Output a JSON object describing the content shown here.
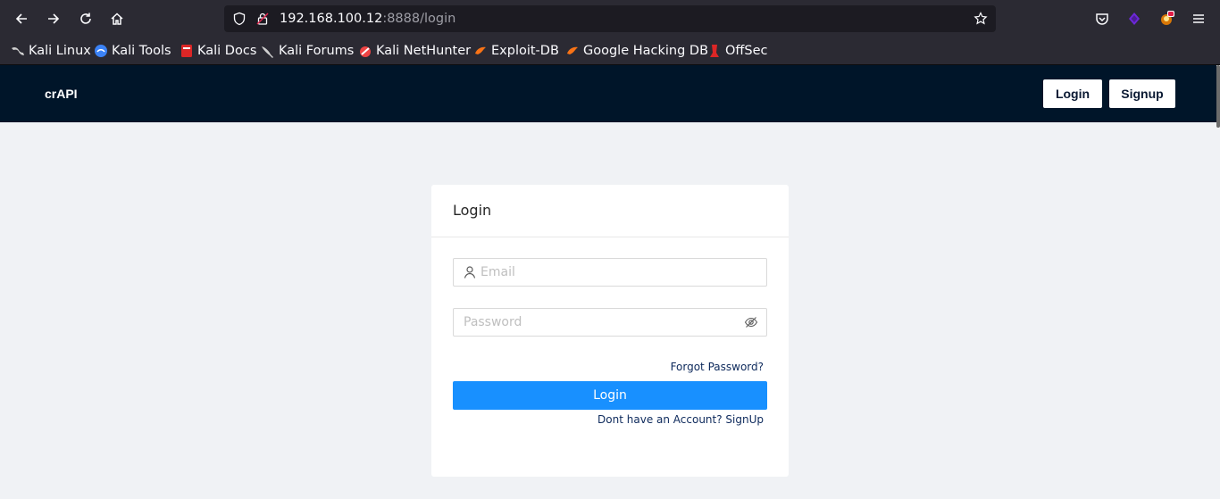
{
  "browser": {
    "url_host": "192.168.100.12",
    "url_rest": ":8888/login",
    "nav_icons": [
      "back-icon",
      "forward-icon",
      "reload-icon",
      "home-icon"
    ],
    "right_icons": [
      "pocket-icon",
      "extension-icon",
      "profile-icon",
      "menu-icon"
    ]
  },
  "bookmarks": [
    {
      "label": "Kali Linux",
      "icon": "kali-dragon-icon",
      "color": "#cfcfcf"
    },
    {
      "label": "Kali Tools",
      "icon": "kali-tools-icon",
      "color": "#3b82f6"
    },
    {
      "label": "Kali Docs",
      "icon": "kali-docs-icon",
      "color": "#dc2626"
    },
    {
      "label": "Kali Forums",
      "icon": "kali-forums-icon",
      "color": "#cfcfcf"
    },
    {
      "label": "Kali NetHunter",
      "icon": "nethunter-icon",
      "color": "#ef4444"
    },
    {
      "label": "Exploit-DB",
      "icon": "exploit-db-icon",
      "color": "#f97316"
    },
    {
      "label": "Google Hacking DB",
      "icon": "ghdb-icon",
      "color": "#f97316"
    },
    {
      "label": "OffSec",
      "icon": "offsec-icon",
      "color": "#dc2626"
    }
  ],
  "app": {
    "brand": "crAPI",
    "nav_login": "Login",
    "nav_signup": "Signup",
    "bg_color": "#001529"
  },
  "login_card": {
    "title": "Login",
    "email_placeholder": "Email",
    "password_placeholder": "Password",
    "forgot_password": "Forgot Password?",
    "login_button": "Login",
    "signup_link": "Dont have an Account? SignUp",
    "accent_color": "#1890ff"
  }
}
